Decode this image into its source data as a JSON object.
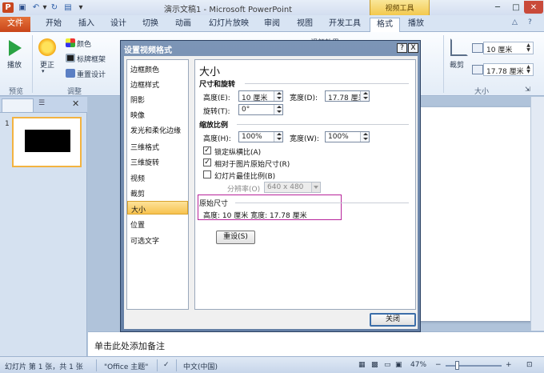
{
  "titlebar": {
    "title": "演示文稿1 - Microsoft PowerPoint",
    "context_tool": "视频工具",
    "qa_ppt": "P"
  },
  "tabs": {
    "file": "文件",
    "items": [
      "开始",
      "插入",
      "设计",
      "切换",
      "动画",
      "幻灯片放映",
      "审阅",
      "视图",
      "开发工具"
    ],
    "format": "格式",
    "playback": "播放"
  },
  "ribbon": {
    "play": "播放",
    "correct": "更正",
    "color": "颜色",
    "frame": "标牌框架",
    "reset_design": "重置设计",
    "group_preview": "预览",
    "group_adjust": "调整",
    "crop": "裁剪",
    "height": "10 厘米",
    "width": "17.78 厘米",
    "group_size": "大小",
    "cutoff_text": "视频效果"
  },
  "dialog": {
    "title": "设置视频格式",
    "help": "?",
    "close_x": "X",
    "nav": [
      "边框颜色",
      "边框样式",
      "阴影",
      "映像",
      "发光和柔化边缘",
      "三维格式",
      "三维旋转",
      "视频",
      "裁剪",
      "大小",
      "位置",
      "可选文字"
    ],
    "selected_nav": "大小",
    "heading": "大小",
    "size_rotate": {
      "title": "尺寸和旋转",
      "height_label": "高度(E):",
      "height_value": "10 厘米",
      "width_label": "宽度(D):",
      "width_value": "17.78 厘米",
      "rotate_label": "旋转(T):",
      "rotate_value": "0°"
    },
    "scale": {
      "title": "缩放比例",
      "height_label": "高度(H):",
      "height_value": "100%",
      "width_label": "宽度(W):",
      "width_value": "100%",
      "lock_ratio": "锁定纵横比(A)",
      "relative": "相对于图片原始尺寸(R)",
      "best_scale": "幻灯片最佳比例(B)",
      "resolution_label": "分辨率(O)",
      "resolution_value": "640 x 480"
    },
    "original": {
      "title": "原始尺寸",
      "text": "高度:  10 厘米  宽度:  17.78 厘米"
    },
    "reset": "重设(S)",
    "close": "关闭"
  },
  "left_panel": {
    "slide_number": "1"
  },
  "notes": {
    "placeholder": "单击此处添加备注"
  },
  "status": {
    "slide_info": "幻灯片 第 1 张，共 1 张",
    "theme": "\"Office 主题\"",
    "language": "中文(中国)",
    "zoom": "47%"
  }
}
